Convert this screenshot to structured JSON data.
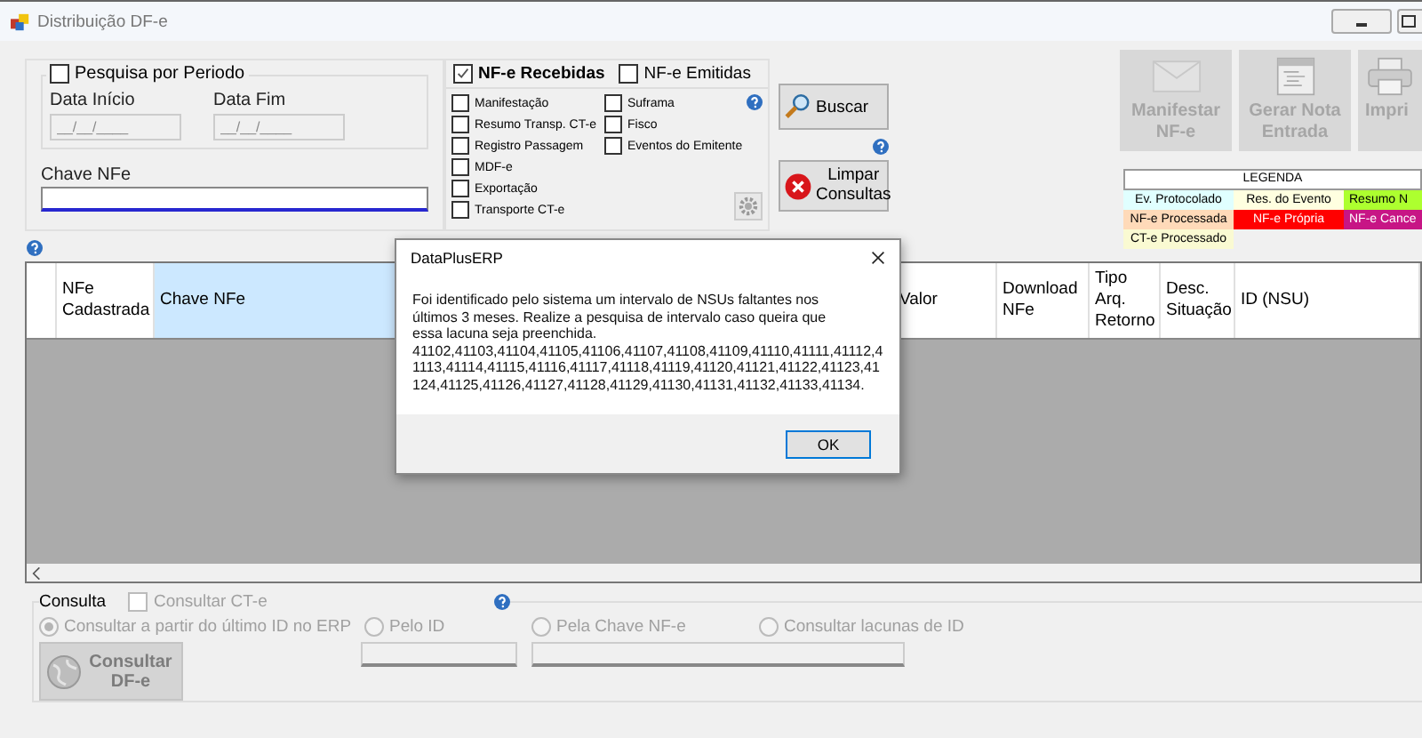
{
  "window": {
    "title": "Distribuição DF-e"
  },
  "period": {
    "label": "Pesquisa por Periodo",
    "checked": false,
    "start_label": "Data Início",
    "start_placeholder": "__/__/____",
    "end_label": "Data Fim",
    "end_placeholder": "__/__/____"
  },
  "chave": {
    "label": "Chave NFe"
  },
  "doc_types": [
    {
      "label": "NF-e Recebidas",
      "checked": true
    },
    {
      "label": "NF-e Emitidas",
      "checked": false
    }
  ],
  "filters_left": [
    {
      "label": "Manifestação",
      "checked": false
    },
    {
      "label": "Resumo Transp. CT-e",
      "checked": false
    },
    {
      "label": "Registro Passagem",
      "checked": false
    },
    {
      "label": "MDF-e",
      "checked": false
    },
    {
      "label": "Exportação",
      "checked": false
    },
    {
      "label": "Transporte CT-e",
      "checked": false
    }
  ],
  "filters_right": [
    {
      "label": "Suframa",
      "checked": false
    },
    {
      "label": "Fisco",
      "checked": false
    },
    {
      "label": "Eventos do Emitente",
      "checked": false
    }
  ],
  "search_button": "Buscar",
  "clear_button": "Limpar Consultas",
  "actions": [
    {
      "kind": "envelope",
      "label": "Manifestar NF-e",
      "disabled": true
    },
    {
      "kind": "document",
      "label": "Gerar Nota Entrada",
      "disabled": true
    },
    {
      "kind": "printer",
      "label": "Impri",
      "disabled": true
    }
  ],
  "legend": {
    "title": "LEGENDA",
    "items": [
      {
        "label": "Ev. Protocolado",
        "color": "#e0ffff"
      },
      {
        "label": "Res. do Evento",
        "color": "#ffffe0"
      },
      {
        "label": "Resumo N",
        "color": "#adff2f"
      },
      {
        "label": "NF-e Processada",
        "color": "#ffdab9"
      },
      {
        "label": "NF-e Própria",
        "color": "#ff0000"
      },
      {
        "label": "NF-e Cance",
        "color": "#c71585"
      },
      {
        "label": "CT-e Processado",
        "color": "#fafad2"
      }
    ]
  },
  "grid": {
    "columns": [
      {
        "label": "NFe Cadastrada",
        "selected": false
      },
      {
        "label": "Chave NFe",
        "selected": true
      },
      {
        "label": "Valor",
        "selected": false
      },
      {
        "label": "Download NFe",
        "selected": false
      },
      {
        "label": "Tipo Arq. Retorno",
        "selected": false
      },
      {
        "label": "Desc. Situação",
        "selected": false
      },
      {
        "label": "ID (NSU)",
        "selected": false
      }
    ]
  },
  "consulta": {
    "title": "Consulta",
    "disabled": true,
    "ct_e": {
      "label": "Consultar CT-e",
      "checked": false
    },
    "options": [
      {
        "label": "Consultar a partir do último ID no ERP",
        "selected": true
      },
      {
        "label": "Pelo ID",
        "selected": false
      },
      {
        "label": "Pela Chave NF-e",
        "selected": false
      },
      {
        "label": "Consultar lacunas de ID",
        "selected": false
      }
    ],
    "button": "Consultar DF-e"
  },
  "dialog": {
    "title": "DataPlusERP",
    "message": "Foi identificado pelo sistema um intervalo de NSUs faltantes nos últimos 3 meses. Realize a pesquisa de intervalo caso queira que essa lacuna seja preenchida.",
    "nsu_list": "41102,41103,41104,41105,41106,41107,41108,41109,41110,41111,41112,41113,41114,41115,41116,41117,41118,41119,41120,41121,41122,41123,41124,41125,41126,41127,41128,41129,41130,41131,41132,41133,41134.",
    "button": "OK"
  }
}
